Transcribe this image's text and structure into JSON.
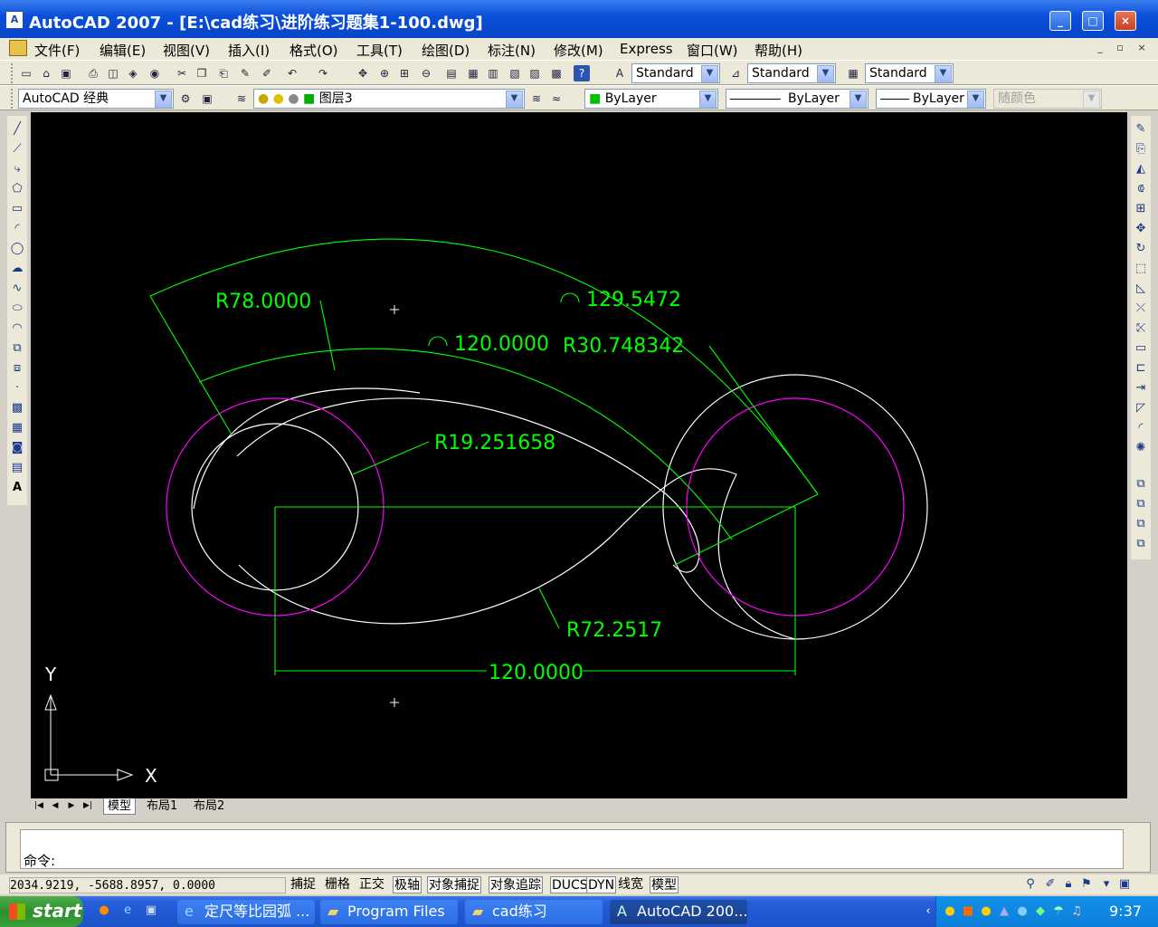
{
  "window": {
    "title": "AutoCAD 2007 - [E:\\cad练习\\进阶练习题集1-100.dwg]",
    "app_icon": "autocad-icon"
  },
  "menu": [
    "文件(F)",
    "编辑(E)",
    "视图(V)",
    "插入(I)",
    "格式(O)",
    "工具(T)",
    "绘图(D)",
    "标注(N)",
    "修改(M)",
    "Express",
    "窗口(W)",
    "帮助(H)"
  ],
  "toolbar1": {
    "text_style": "Standard",
    "dim_style": "Standard",
    "table_style": "Standard"
  },
  "toolbar2": {
    "workspace": "AutoCAD 经典",
    "layer": "图层3",
    "color": "ByLayer",
    "linetype": "ByLayer",
    "lineweight": "ByLayer",
    "plotstyle": "随颜色"
  },
  "drawing": {
    "dimensions": {
      "r78": "R78.0000",
      "arc129": "129.5472",
      "arc120": "120.0000",
      "r30": "R30.748342",
      "r19": "R19.251658",
      "r72": "R72.2517",
      "lin120": "120.0000"
    },
    "ucs": {
      "x_label": "X",
      "y_label": "Y"
    },
    "colors": {
      "geometry": "#ffffff",
      "dimension": "#00ff00",
      "layer_circle": "#ff00ff"
    }
  },
  "tabs": [
    "模型",
    "布局1",
    "布局2"
  ],
  "command": {
    "prompt": "命令:"
  },
  "status": {
    "coords": "2034.9219,  -5688.8957, 0.0000",
    "toggles": [
      {
        "label": "捕捉",
        "on": false
      },
      {
        "label": "栅格",
        "on": false
      },
      {
        "label": "正交",
        "on": false
      },
      {
        "label": "极轴",
        "on": true
      },
      {
        "label": "对象捕捉",
        "on": true
      },
      {
        "label": "对象追踪",
        "on": true
      },
      {
        "label": "DUCS",
        "on": true
      },
      {
        "label": "DYN",
        "on": true
      },
      {
        "label": "线宽",
        "on": false
      },
      {
        "label": "模型",
        "on": true
      }
    ]
  },
  "taskbar": {
    "start": "start",
    "tasks": [
      "定尺等比园弧 ...",
      "Program Files",
      "cad练习",
      "AutoCAD 200..."
    ],
    "clock": "9:37"
  }
}
